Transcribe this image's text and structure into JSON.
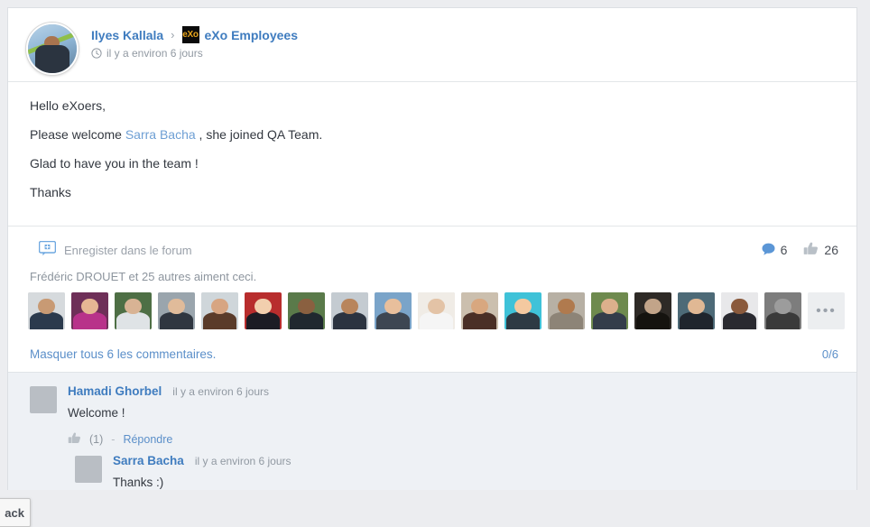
{
  "activity": {
    "author_name": "Ilyes Kallala",
    "separator": "›",
    "space_badge_text": "eXo",
    "space_name": "eXo Employees",
    "time": "il y a environ 6 jours",
    "clock_icon": "clock-icon",
    "body_lines": [
      {
        "text": "Hello eXoers,"
      },
      {
        "prefix": "Please welcome ",
        "link": "Sarra Bacha",
        "suffix": " , she joined QA Team."
      },
      {
        "text": "Glad to have you in the team !"
      },
      {
        "text": "Thanks"
      }
    ]
  },
  "actions": {
    "save_to_forum_label": "Enregister dans le forum",
    "save_icon": "comment-plus-icon",
    "comment_icon": "comment-bubble-icon",
    "comment_count": "6",
    "like_icon": "thumbs-up-icon",
    "like_count": "26"
  },
  "likers": {
    "summary": "Frédéric DROUET et 25 autres aiment ceci.",
    "more_label": "•••",
    "avatars": [
      {
        "bg": "#d6dadd",
        "skin": "#c89a74",
        "cloth": "#2b3a4d"
      },
      {
        "bg": "#6e2f58",
        "skin": "#e6b694",
        "cloth": "#b8328a"
      },
      {
        "bg": "#4e6f45",
        "skin": "#d8b394",
        "cloth": "#dfe3e6"
      },
      {
        "bg": "#9aa5ad",
        "skin": "#e0bb9a",
        "cloth": "#2f3640"
      },
      {
        "bg": "#cfd6da",
        "skin": "#d7a582",
        "cloth": "#5a3b2a"
      },
      {
        "bg": "#b82d2d",
        "skin": "#f2cfae",
        "cloth": "#1c1c24"
      },
      {
        "bg": "#5a7a4a",
        "skin": "#8a6040",
        "cloth": "#20282f"
      },
      {
        "bg": "#c4cbd1",
        "skin": "#b8855c",
        "cloth": "#2b3340"
      },
      {
        "bg": "#7aa4c9",
        "skin": "#e8bf9c",
        "cloth": "#3d4652"
      },
      {
        "bg": "#f0ece6",
        "skin": "#e3c3a6",
        "cloth": "#f5f5f5"
      },
      {
        "bg": "#cbbfae",
        "skin": "#d8a77f",
        "cloth": "#4a2f26"
      },
      {
        "bg": "#3fc2d8",
        "skin": "#f4c9a0",
        "cloth": "#2e3a44"
      },
      {
        "bg": "#b7b0a4",
        "skin": "#b07a4e",
        "cloth": "#8d8477"
      },
      {
        "bg": "#6e8a4e",
        "skin": "#dcb08c",
        "cloth": "#343d4a"
      },
      {
        "bg": "#2e2a26",
        "skin": "#c2a489",
        "cloth": "#15130f"
      },
      {
        "bg": "#4d6a77",
        "skin": "#e0b894",
        "cloth": "#1f252d"
      },
      {
        "bg": "#e8e8ea",
        "skin": "#8a5a3c",
        "cloth": "#2a2a30"
      },
      {
        "bg": "#7d7d7d",
        "skin": "#9c9c9c",
        "cloth": "#3a3a3a"
      }
    ]
  },
  "comments_toggle": {
    "label": "Masquer tous 6 les commentaires.",
    "counter": "0/6"
  },
  "comments": [
    {
      "name": "Hamadi Ghorbel",
      "time": "il y a environ 6 jours",
      "text": "Welcome !",
      "like_icon": "thumbs-up-icon",
      "like_count": "(1)",
      "dash": "-",
      "reply_label": "Répondre",
      "nested": false,
      "avatar": {
        "bg": "#7f8d99",
        "skin": "#c49a72",
        "cloth": "#20262e"
      }
    },
    {
      "name": "Sarra Bacha",
      "time": "il y a environ 6 jours",
      "text": "Thanks :)",
      "nested": true,
      "avatar": {
        "bg": "#3d6b4a",
        "skin": "#e0b28c",
        "cloth": "#1a1216"
      }
    }
  ],
  "feedback_tab": {
    "label": "ack"
  },
  "colors": {
    "link": "#3f7cbf",
    "muted": "#9199a2",
    "comment_badge": "#5b96d6",
    "like_badge": "#b9c0c7",
    "page_bg": "#ecedf0",
    "comments_bg": "#eef1f5",
    "badge_gold": "#e8a51c"
  }
}
